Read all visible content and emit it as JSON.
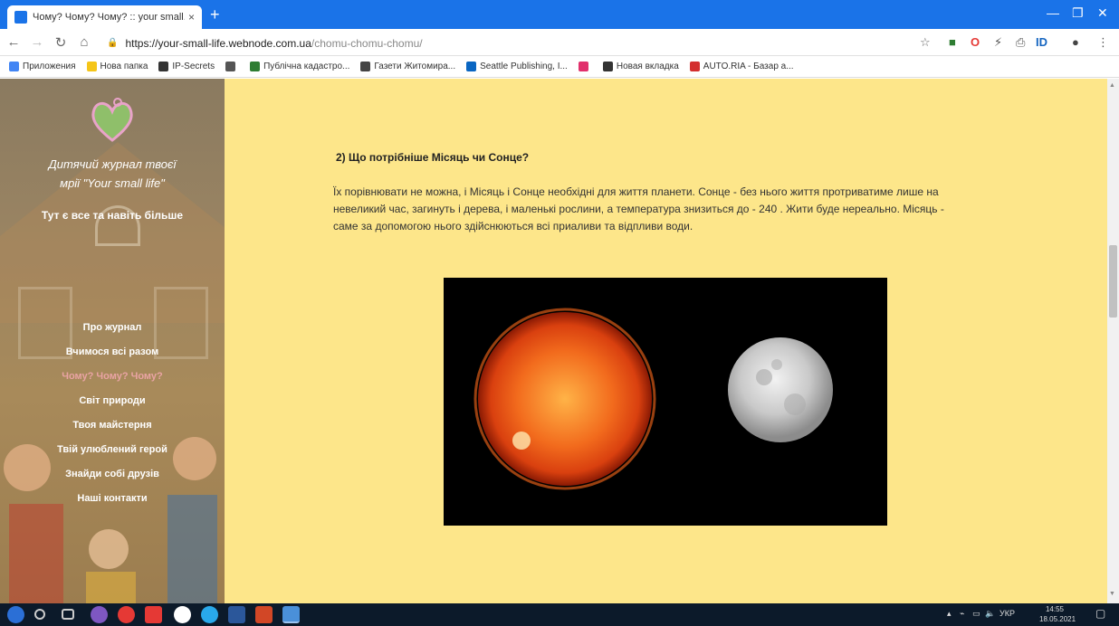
{
  "browser": {
    "tab_title": "Чому? Чому? Чому? :: your small...",
    "tab_close": "×",
    "new_tab": "+",
    "url_host": "https://your-small-life.webnode.com.ua",
    "url_path": "/chomu-chomu-chomu/",
    "bookmarks": [
      {
        "label": "Приложения",
        "color": "#4285f4"
      },
      {
        "label": "Нова папка",
        "color": "#f5c518"
      },
      {
        "label": "IP-Secrets",
        "color": "#333333"
      },
      {
        "label": "",
        "color": "#555555"
      },
      {
        "label": "Публічна кадастро...",
        "color": "#2e7d32"
      },
      {
        "label": "Газети Житомира...",
        "color": "#444444"
      },
      {
        "label": "Seattle Publishing, I...",
        "color": "#0a66c2"
      },
      {
        "label": "",
        "color": "#e1306c"
      },
      {
        "label": "Новая вкладка",
        "color": "#333333"
      },
      {
        "label": "AUTO.RIA - Базар а...",
        "color": "#d32f2f"
      }
    ]
  },
  "sidebar": {
    "title_line1": "Дитячий журнал твоєї",
    "title_line2": "мрії \"Your small life\"",
    "subtitle": "Тут є все та навіть більше",
    "nav": [
      {
        "label": "Про журнал",
        "active": false
      },
      {
        "label": "Вчимося всі разом",
        "active": false
      },
      {
        "label": "Чому? Чому? Чому?",
        "active": true
      },
      {
        "label": "Світ природи",
        "active": false
      },
      {
        "label": "Твоя майстерня",
        "active": false
      },
      {
        "label": "Твій улюблений герой",
        "active": false
      },
      {
        "label": "Знайди собі друзів",
        "active": false
      },
      {
        "label": "Наші контакти",
        "active": false
      }
    ]
  },
  "content": {
    "question": "2) Що потрібніше Місяць чи Сонце?",
    "answer": "Їх порівнювати не можна, і Місяць і Сонце необхідні для життя планети. Сонце - без нього життя протриватиме лише на невеликий час, загинуть і дерева, і маленькі рослини, а температура знизиться до - 240 . Жити буде нереально. Місяць - саме за допомогою нього здійснюються всі приаливи та відпливи води."
  },
  "taskbar": {
    "lang": "УКР",
    "time": "14:55",
    "date": "18.05.2021"
  }
}
